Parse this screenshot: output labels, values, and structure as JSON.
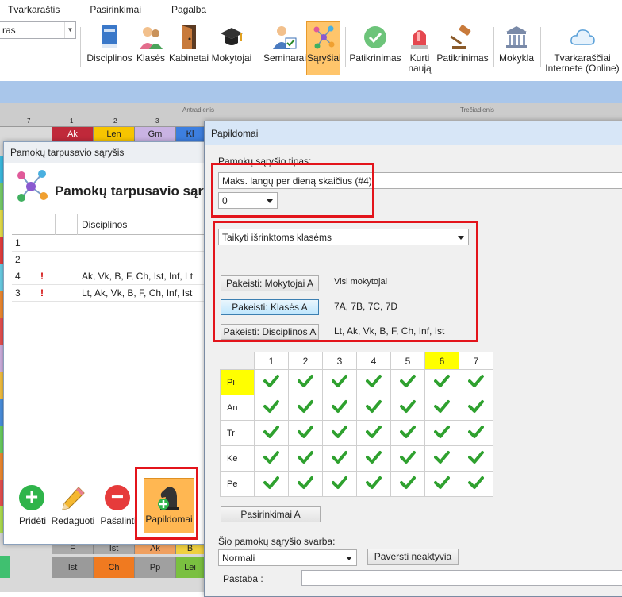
{
  "menu": [
    "Tvarkaraštis",
    "Pasirinkimai",
    "Pagalba"
  ],
  "ribbon": {
    "combo_value": "ras",
    "buttons": [
      {
        "id": "disciplinos",
        "label": "Disciplinos"
      },
      {
        "id": "klases",
        "label": "Klasės"
      },
      {
        "id": "kabinetai",
        "label": "Kabinetai"
      },
      {
        "id": "mokytojai",
        "label": "Mokytojai"
      },
      {
        "id": "seminarai",
        "label": "Seminarai"
      },
      {
        "id": "sarysiai",
        "label": "Sąryšiai"
      },
      {
        "id": "patikrinimas1",
        "label": "Patikrinimas"
      },
      {
        "id": "kurti",
        "label": "Kurti naują"
      },
      {
        "id": "patikrinimas2",
        "label": "Patikrinimas"
      },
      {
        "id": "mokykla",
        "label": "Mokykla"
      },
      {
        "id": "internetas",
        "label": "Tvarkaraščiai Internete (Online)"
      }
    ]
  },
  "background": {
    "days": [
      "Antradienis",
      "Trečiadienis"
    ],
    "col_numbers": [
      "7",
      "1",
      "2",
      "3"
    ],
    "top_cells": [
      "Ak",
      "Len",
      "Gm",
      "Kl"
    ],
    "bottom_row1": [
      "F",
      "Ist",
      "Ak",
      "B"
    ],
    "bottom_row2": [
      "Ist",
      "Ch",
      "Pp",
      "Lei"
    ]
  },
  "left_dialog": {
    "title": "Pamokų tarpusavio sąryšis",
    "heading": "Pamokų tarpusavio sąryšiai",
    "col_header": "Disciplinos",
    "rows": [
      {
        "num": "1",
        "flag": "",
        "disc": ""
      },
      {
        "num": "2",
        "flag": "",
        "disc": ""
      },
      {
        "num": "4",
        "flag": "!",
        "disc": "Ak, Vk, B, F, Ch, Ist, Inf, Lt"
      },
      {
        "num": "3",
        "flag": "!",
        "disc": "Lt, Ak, Vk, B, F, Ch, Inf, Ist"
      }
    ],
    "buttons": {
      "add": "Pridėti",
      "edit": "Redaguoti",
      "remove": "Pašalinti",
      "extra": "Papildomai"
    }
  },
  "right_dialog": {
    "title": "Papildomai",
    "type_label": "Pamokų sąryšio tipas:",
    "type_value": "Maks. langų per dieną skaičius (#4)",
    "count_value": "0",
    "apply_value": "Taikyti išrinktoms klasėms",
    "teachers_btn": "Pakeisti: Mokytojai A",
    "teachers_val": "Visi mokytojai",
    "classes_btn": "Pakeisti: Klasės A",
    "classes_val": "7A, 7B, 7C, 7D",
    "subjects_btn": "Pakeisti: Disciplinos A",
    "subjects_val": "Lt, Ak, Vk, B, F, Ch, Inf, Ist",
    "grid_cols": [
      "1",
      "2",
      "3",
      "4",
      "5",
      "6",
      "7"
    ],
    "grid_rows": [
      "Pi",
      "An",
      "Tr",
      "Ke",
      "Pe"
    ],
    "highlight_col": "6",
    "highlight_row": "Pi",
    "options_btn": "Pasirinkimai A",
    "weight_label": "Šio pamokų sąryšio svarba:",
    "weight_value": "Normali",
    "inactive_btn": "Paversti neaktyvia",
    "note_label": "Pastaba :"
  }
}
